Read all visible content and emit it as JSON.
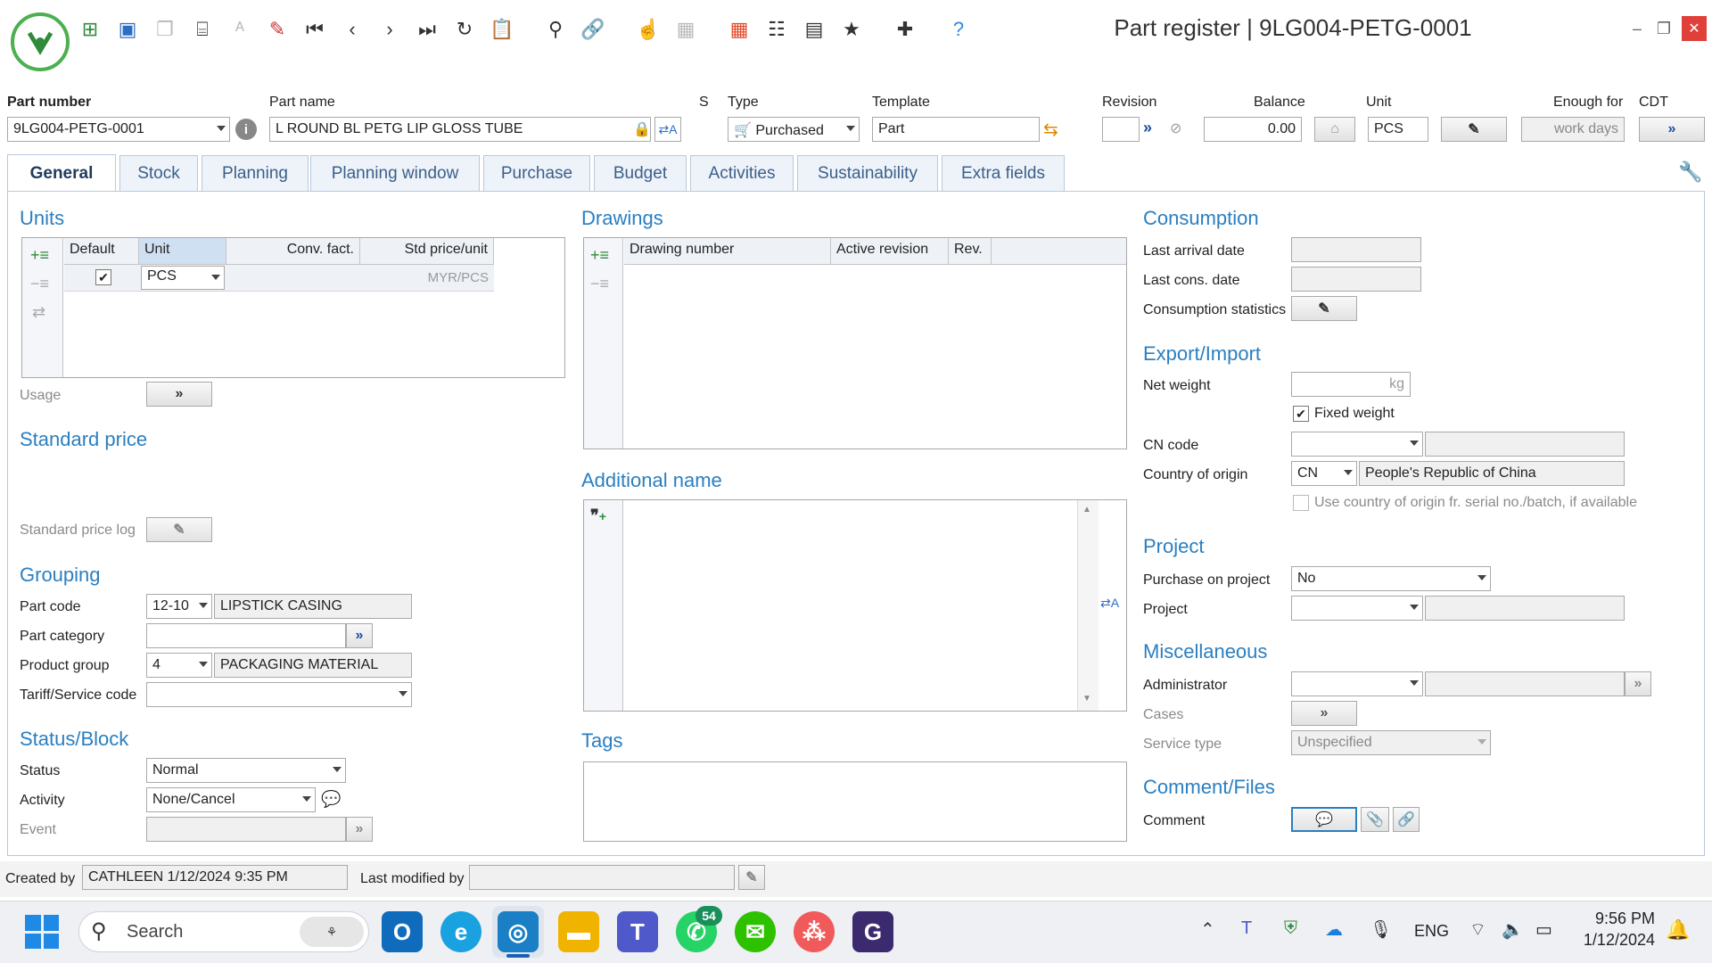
{
  "window": {
    "title": "Part register | 9LG004-PETG-0001"
  },
  "header": {
    "part_number_label": "Part number",
    "part_number": "9LG004-PETG-0001",
    "part_name_label": "Part name",
    "part_name": "L ROUND BL PETG LIP GLOSS TUBE",
    "s_label": "S",
    "type_label": "Type",
    "type": "Purchased",
    "template_label": "Template",
    "template": "Part",
    "revision_label": "Revision",
    "balance_label": "Balance",
    "balance": "0.00",
    "unit_label": "Unit",
    "unit": "PCS",
    "enough_for_label": "Enough for",
    "enough_for_placeholder": "work days",
    "cdt_label": "CDT"
  },
  "tabs": [
    "General",
    "Stock",
    "Planning",
    "Planning window",
    "Purchase",
    "Budget",
    "Activities",
    "Sustainability",
    "Extra fields"
  ],
  "units": {
    "title": "Units",
    "columns": [
      "Default",
      "Unit",
      "Conv. fact.",
      "Std price/unit"
    ],
    "row": {
      "unit": "PCS",
      "std_price": "MYR/PCS"
    },
    "usage_label": "Usage"
  },
  "standard_price": {
    "title": "Standard price",
    "log_label": "Standard price log"
  },
  "grouping": {
    "title": "Grouping",
    "part_code_label": "Part code",
    "part_code": "12-10",
    "part_code_desc": "LIPSTICK CASING",
    "part_category_label": "Part category",
    "product_group_label": "Product group",
    "product_group": "4",
    "product_group_desc": "PACKAGING MATERIAL",
    "tariff_label": "Tariff/Service code"
  },
  "status_block": {
    "title": "Status/Block",
    "status_label": "Status",
    "status": "Normal",
    "activity_label": "Activity",
    "activity": "None/Cancel",
    "event_label": "Event"
  },
  "drawings": {
    "title": "Drawings",
    "columns": [
      "Drawing number",
      "Active revision",
      "Rev."
    ]
  },
  "additional_name": {
    "title": "Additional name"
  },
  "tags": {
    "title": "Tags"
  },
  "consumption": {
    "title": "Consumption",
    "last_arrival_label": "Last arrival date",
    "last_cons_label": "Last cons. date",
    "stats_label": "Consumption statistics"
  },
  "export_import": {
    "title": "Export/Import",
    "net_weight_label": "Net weight",
    "net_weight_unit": "kg",
    "fixed_weight_label": "Fixed weight",
    "cn_code_label": "CN code",
    "country_label": "Country of origin",
    "country_code": "CN",
    "country_name": "People's Republic of China",
    "use_country_label": "Use country of origin fr. serial no./batch, if available"
  },
  "project": {
    "title": "Project",
    "purchase_on_project_label": "Purchase on project",
    "purchase_on_project": "No",
    "project_label": "Project"
  },
  "misc": {
    "title": "Miscellaneous",
    "administrator_label": "Administrator",
    "cases_label": "Cases",
    "service_type_label": "Service type",
    "service_type": "Unspecified"
  },
  "comment_files": {
    "title": "Comment/Files",
    "comment_label": "Comment"
  },
  "footer": {
    "created_by_label": "Created by",
    "created_by": "CATHLEEN 1/12/2024 9:35 PM",
    "modified_by_label": "Last modified by"
  },
  "taskbar": {
    "search_placeholder": "Search",
    "whatsapp_badge": "54",
    "lang": "ENG",
    "time": "9:56 PM",
    "date": "1/12/2024"
  }
}
